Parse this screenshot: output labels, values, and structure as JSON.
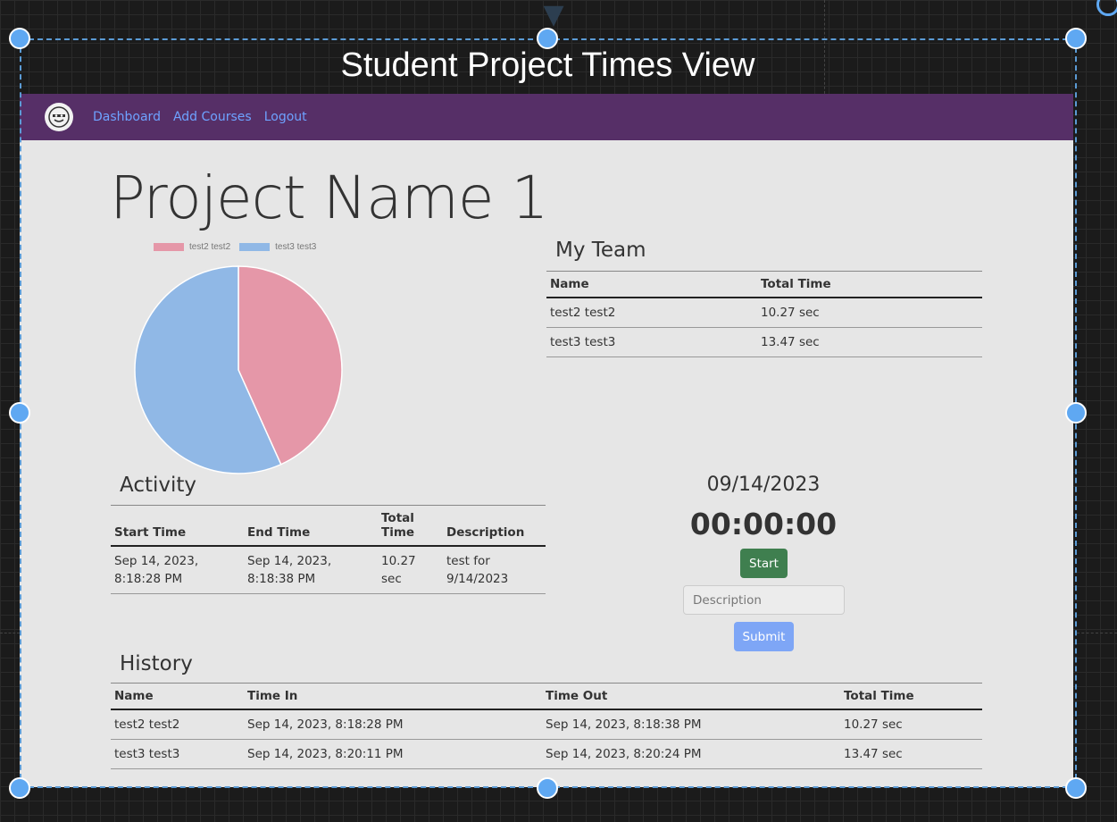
{
  "frame": {
    "title": "Student Project Times View"
  },
  "navbar": {
    "bg_color": "#562f67",
    "links": [
      "Dashboard",
      "Add Courses",
      "Logout"
    ]
  },
  "page": {
    "title": "Project Name 1"
  },
  "chart": {
    "legend": [
      {
        "label": "test2 test2",
        "color": "#e597a8"
      },
      {
        "label": "test3 test3",
        "color": "#90b8e6"
      }
    ]
  },
  "chart_data": {
    "type": "pie",
    "title": "",
    "labels": [
      "test2 test2",
      "test3 test3"
    ],
    "values": [
      10.27,
      13.47
    ],
    "colors": [
      "#e597a8",
      "#90b8e6"
    ],
    "legend_position": "top"
  },
  "team": {
    "heading": "My Team",
    "headers": [
      "Name",
      "Total Time"
    ],
    "rows": [
      [
        "test2 test2",
        "10.27 sec"
      ],
      [
        "test3 test3",
        "13.47 sec"
      ]
    ]
  },
  "activity": {
    "heading": "Activity",
    "headers": [
      "Start Time",
      "End Time",
      "Total Time",
      "Description"
    ],
    "rows": [
      [
        "Sep 14, 2023, 8:18:28 PM",
        "Sep 14, 2023, 8:18:38 PM",
        "10.27 sec",
        "test for 9/14/2023"
      ]
    ]
  },
  "timer": {
    "date": "09/14/2023",
    "time": "00:00:00",
    "start_label": "Start",
    "description_placeholder": "Description",
    "submit_label": "Submit"
  },
  "history": {
    "heading": "History",
    "headers": [
      "Name",
      "Time In",
      "Time Out",
      "Total Time"
    ],
    "rows": [
      [
        "test2 test2",
        "Sep 14, 2023, 8:18:28 PM",
        "Sep 14, 2023, 8:18:38 PM",
        "10.27 sec"
      ],
      [
        "test3 test3",
        "Sep 14, 2023, 8:20:11 PM",
        "Sep 14, 2023, 8:20:24 PM",
        "13.47 sec"
      ]
    ]
  }
}
